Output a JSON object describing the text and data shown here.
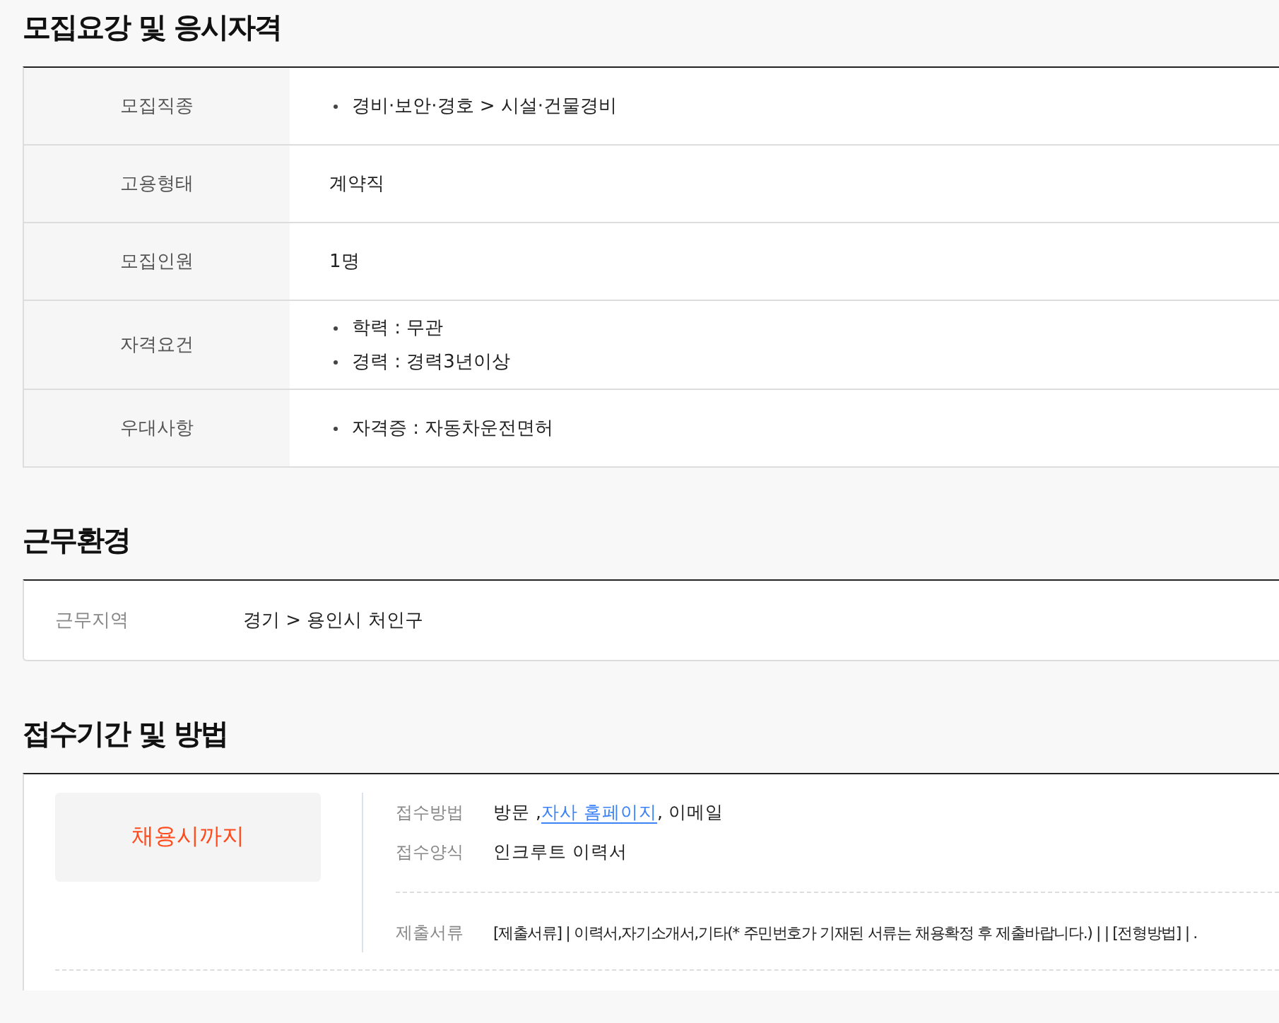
{
  "recruitment": {
    "title": "모집요강 및 응시자격",
    "rows": [
      {
        "label": "모집직종",
        "kind": "bullets",
        "values": [
          "경비·보안·경호 > 시설·건물경비"
        ]
      },
      {
        "label": "고용형태",
        "kind": "plain",
        "values": [
          "계약직"
        ]
      },
      {
        "label": "모집인원",
        "kind": "plain",
        "values": [
          "1명"
        ]
      },
      {
        "label": "자격요건",
        "kind": "bullets",
        "values": [
          "학력 : 무관",
          "경력 : 경력3년이상"
        ]
      },
      {
        "label": "우대사항",
        "kind": "bullets",
        "values": [
          "자격증 : 자동차운전면허"
        ]
      }
    ]
  },
  "work_environment": {
    "title": "근무환경",
    "rows": [
      {
        "label": "근무지역",
        "value": "경기 > 용인시 처인구"
      }
    ]
  },
  "application": {
    "title": "접수기간 및 방법",
    "deadline": "채용시까지",
    "rows": [
      {
        "label": "접수방법",
        "parts": [
          {
            "kind": "text",
            "text": "방문 ,"
          },
          {
            "kind": "link",
            "text": "자사 홈페이지"
          },
          {
            "kind": "text",
            "text": ", 이메일"
          }
        ]
      },
      {
        "label": "접수양식",
        "parts": [
          {
            "kind": "text",
            "text": "인크루트 이력서"
          }
        ]
      }
    ],
    "documents": {
      "label": "제출서류",
      "value": "[제출서류] | 이력서,자기소개서,기타(* 주민번호가 기재된 서류는 채용확정 후 제출바랍니다.) | | [전형방법] | ."
    }
  }
}
